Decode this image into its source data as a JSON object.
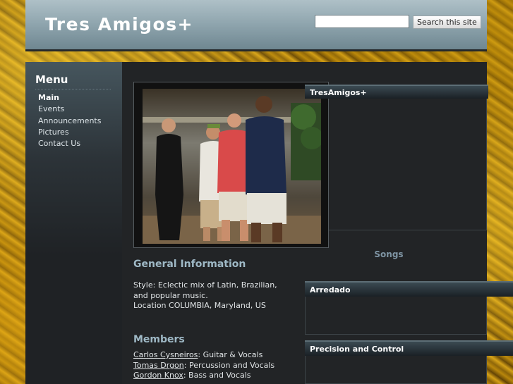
{
  "header": {
    "site_title": "Tres Amigos+",
    "search_placeholder": "",
    "search_button_label": "Search this site"
  },
  "sidebar": {
    "title": "Menu",
    "items": [
      {
        "label": "Main",
        "active": true
      },
      {
        "label": "Events"
      },
      {
        "label": "Announcements"
      },
      {
        "label": "Pictures"
      },
      {
        "label": "Contact Us"
      }
    ]
  },
  "main": {
    "general_heading": "General Information",
    "style_line": "Style: Eclectic mix of Latin, Brazilian, and popular music.",
    "location_line": "Location COLUMBIA, Maryland, US",
    "members_heading": "Members",
    "members": [
      {
        "name": "Carlos Cysneiros",
        "role": ": Guitar & Vocals"
      },
      {
        "name": "Tomas Drgon",
        "role": ": Percussion and Vocals"
      },
      {
        "name": "Gordon Knox",
        "role": ": Bass and Vocals"
      }
    ]
  },
  "right": {
    "panel_title": "TresAmigos+",
    "songs_heading": "Songs",
    "songs": [
      {
        "title": "Arredado"
      },
      {
        "title": "Precision and Control"
      }
    ]
  },
  "colors": {
    "header": "#8ea4ad",
    "body_background": "#b8860b",
    "content_background": "#222426",
    "heading_accent": "#9fb9c6"
  },
  "icons": {
    "photo": "band-photo"
  }
}
